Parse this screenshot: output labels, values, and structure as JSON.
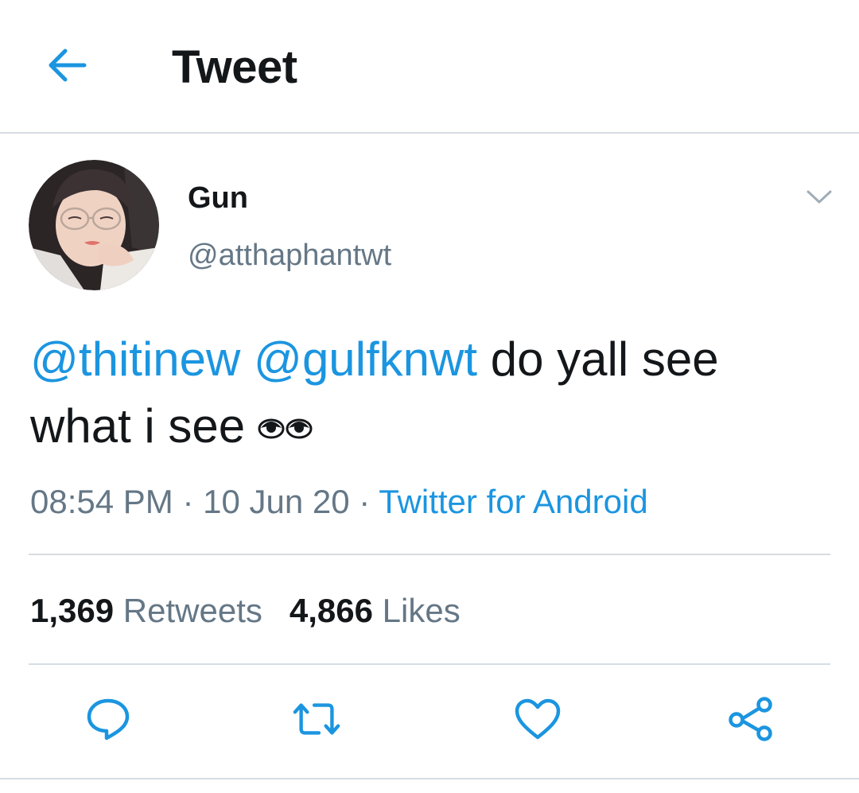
{
  "header": {
    "title": "Tweet",
    "back_icon": "arrow-left-icon",
    "accent_color": "#1b95e0"
  },
  "author": {
    "name": "Gun",
    "handle": "@atthaphantwt",
    "avatar_icon": "avatar-photo"
  },
  "tweet": {
    "mention_1": "@thitinew",
    "mention_2": "@gulfknwt",
    "text_part_1": "do yall see",
    "text_part_2": "what i see",
    "emoji_icon": "eyes-emoji"
  },
  "meta": {
    "time": "08:54 PM",
    "separator": "·",
    "date": "10 Jun 20",
    "source": "Twitter for Android"
  },
  "stats": {
    "retweets_count": "1,369",
    "retweets_label": "Retweets",
    "likes_count": "4,866",
    "likes_label": "Likes"
  },
  "actions": {
    "icons": [
      "reply-icon",
      "retweet-icon",
      "like-icon",
      "share-icon"
    ],
    "icon_color": "#1b95e0"
  },
  "colors": {
    "text": "#14171a",
    "secondary": "#657786",
    "link": "#1b95e0",
    "divider": "#d6dde3"
  }
}
